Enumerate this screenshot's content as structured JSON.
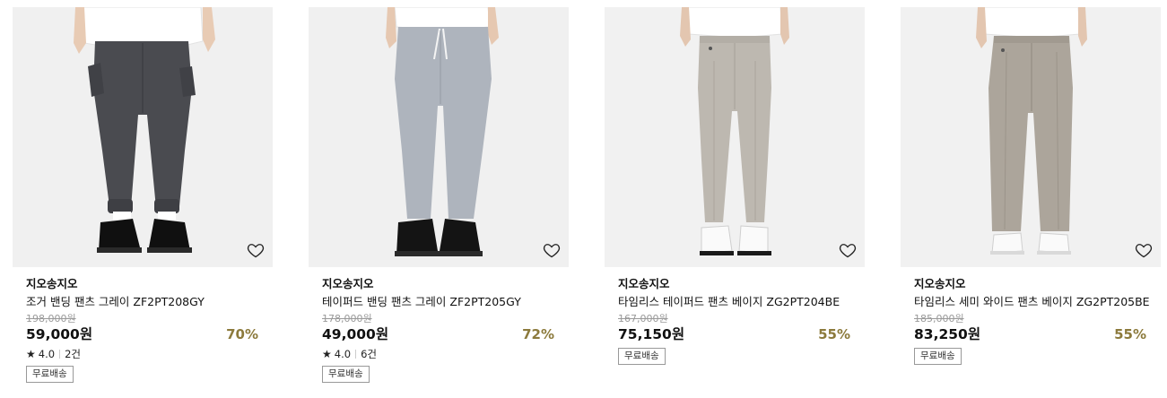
{
  "products": [
    {
      "brand": "지오송지오",
      "title": "조거 밴딩 팬츠 그레이 ZF2PT208GY",
      "original_price": "198,000원",
      "price": "59,000원",
      "discount": "70%",
      "rating": "4.0",
      "review_count": "2건",
      "shipping_badge": "무료배송",
      "bg_color": "#f0f0f0",
      "pants_color": "#4a4b50",
      "style": "jogger"
    },
    {
      "brand": "지오송지오",
      "title": "테이퍼드 밴딩 팬츠 그레이 ZF2PT205GY",
      "original_price": "178,000원",
      "price": "49,000원",
      "discount": "72%",
      "rating": "4.0",
      "review_count": "6건",
      "shipping_badge": "무료배송",
      "bg_color": "#f0f0f0",
      "pants_color": "#aeb4bd",
      "style": "tapered"
    },
    {
      "brand": "지오송지오",
      "title": "타임리스 테이퍼드 팬츠 베이지 ZG2PT204BE",
      "original_price": "167,000원",
      "price": "75,150원",
      "discount": "55%",
      "rating": "",
      "review_count": "",
      "shipping_badge": "무료배송",
      "bg_color": "#f1f1f1",
      "pants_color": "#bdb8b0",
      "style": "straight"
    },
    {
      "brand": "지오송지오",
      "title": "타임리스 세미 와이드 팬츠 베이지 ZG2PT205BE",
      "original_price": "185,000원",
      "price": "83,250원",
      "discount": "55%",
      "rating": "",
      "review_count": "",
      "shipping_badge": "무료배송",
      "bg_color": "#f1f1f1",
      "pants_color": "#aca59b",
      "style": "wide"
    }
  ]
}
